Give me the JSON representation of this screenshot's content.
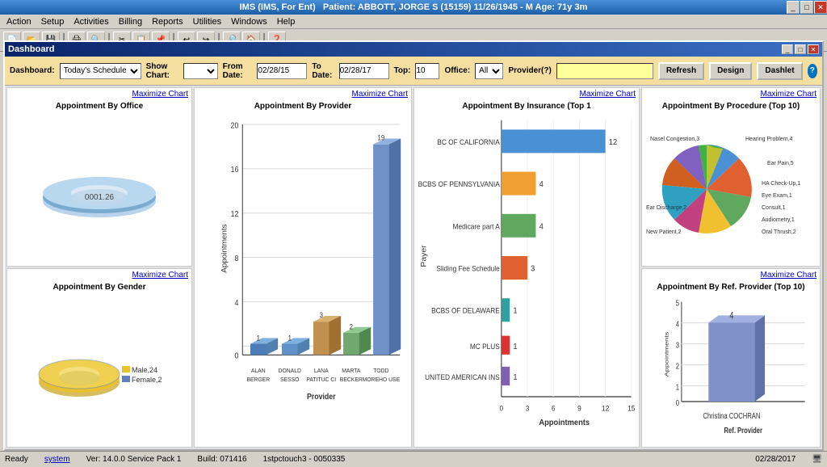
{
  "app": {
    "title": "IMS (IMS, For Ent)",
    "patient_info": "Patient: ABBOTT, JORGE S (15159) 11/26/1945 - M Age: 71y 3m"
  },
  "menu": {
    "items": [
      "Action",
      "Setup",
      "Activities",
      "Billing",
      "Reports",
      "Utilities",
      "Windows",
      "Help"
    ]
  },
  "dashboard": {
    "title": "Dashboard",
    "controls": {
      "dashboard_label": "Dashboard:",
      "dashboard_value": "Today's Schedule",
      "show_chart_label": "Show Chart:",
      "from_date_label": "From Date:",
      "from_date_value": "02/28/15",
      "to_date_label": "To Date:",
      "to_date_value": "02/28/17",
      "top_label": "Top:",
      "top_value": "10",
      "office_label": "Office:",
      "office_value": "All",
      "provider_label": "Provider(?)",
      "provider_value": "",
      "refresh_btn": "Refresh",
      "design_btn": "Design",
      "dashlet_btn": "Dashlet"
    },
    "charts": {
      "office": {
        "maximize": "Maximize Chart",
        "title": "Appointment By Office",
        "value": "0001.26"
      },
      "gender": {
        "maximize": "Maximize Chart",
        "title": "Appointment By Gender",
        "male_label": "Male,24",
        "female_label": "Female,2"
      },
      "provider": {
        "maximize": "Maximize Chart",
        "title": "Appointment By Provider",
        "providers": [
          "ALAN BERGER",
          "DONALD SESSO",
          "LANA PATITUC CI",
          "MARTA BECKER",
          "TODD MOREHO USE"
        ],
        "values": [
          1,
          1,
          3,
          2,
          19
        ],
        "y_max": 20,
        "y_labels": [
          0,
          4,
          8,
          12,
          16,
          20
        ],
        "y_axis_label": "Appointments",
        "x_axis_label": "Provider"
      },
      "insurance": {
        "maximize": "Maximize Chart",
        "title": "Appointment By Insurance (Top 1",
        "payers": [
          {
            "name": "BC OF CALIFORNIA",
            "value": 12
          },
          {
            "name": "BCBS OF PENNSYLVANIA",
            "value": 4
          },
          {
            "name": "Medicare part A",
            "value": 4
          },
          {
            "name": "Sliding Fee Schedule",
            "value": 3
          },
          {
            "name": "BCBS OF DELAWARE",
            "value": 1
          },
          {
            "name": "MC PLUS",
            "value": 1
          },
          {
            "name": "UNITED AMERICAN INS",
            "value": 1
          }
        ],
        "x_labels": [
          0,
          3,
          6,
          9,
          12,
          15
        ],
        "x_axis_label": "Appointments",
        "y_axis_label": "Payer"
      },
      "procedure": {
        "maximize": "Maximize Chart",
        "title": "Appointment By Procedure (Top 10)",
        "items": [
          "Hearing Problem,4",
          "Ear Pain,5",
          "Nasel Congestion,3",
          "HA Check-Up,1",
          "Eye Exam,1",
          "Consult,1",
          "Audiometry,1",
          "Oral Thrush,2",
          "New Patient,2",
          "Ear Discharge,2"
        ]
      },
      "ref_provider": {
        "maximize": "Maximize Chart",
        "title": "Appointment By Ref. Provider (Top 10)",
        "providers": [
          "Christina COCHRAN"
        ],
        "values": [
          4
        ],
        "y_max": 5,
        "y_labels": [
          0,
          1,
          2,
          3,
          4,
          5
        ],
        "y_axis_label": "Appointments",
        "x_axis_label": "Ref. Provider"
      }
    }
  },
  "status_bar": {
    "ready": "Ready",
    "system": "system",
    "version": "Ver: 14.0.0 Service Pack 1",
    "build": "Build: 071416",
    "instance": "1stpctouch3 - 0050335",
    "date": "02/28/2017"
  }
}
